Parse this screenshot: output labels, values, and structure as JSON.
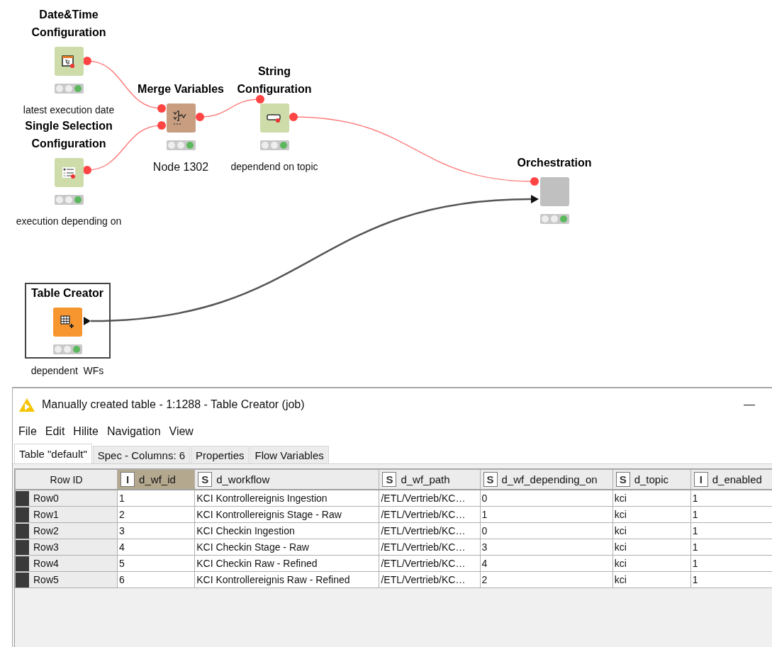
{
  "workflow": {
    "nodes": [
      {
        "kind": "datetime",
        "title": [
          "Date&Time",
          "Configuration"
        ],
        "label": "latest execution date",
        "default_label": false,
        "executed": true,
        "selected": false
      },
      {
        "kind": "selection",
        "title": [
          "Single Selection",
          "Configuration"
        ],
        "label": "execution depending on",
        "default_label": false,
        "executed": true,
        "selected": false
      },
      {
        "kind": "merge",
        "title": [
          "Merge Variables"
        ],
        "label": "Node 1302",
        "default_label": true,
        "executed": true,
        "selected": false
      },
      {
        "kind": "string",
        "title": [
          "String",
          "Configuration"
        ],
        "label": "dependend on topic",
        "default_label": false,
        "executed": true,
        "selected": false
      },
      {
        "kind": "component",
        "title": [
          "Orchestration"
        ],
        "executed": true,
        "selected": false
      },
      {
        "kind": "table",
        "title": [
          "Table Creator"
        ],
        "label": "dependent  WFs",
        "default_label": false,
        "executed": true,
        "selected": true
      }
    ]
  },
  "table_view": {
    "title": "Manually created table - 1:1288 - Table Creator (job)",
    "minimize": "—",
    "menu": [
      "File",
      "Edit",
      "Hilite",
      "Navigation",
      "View"
    ],
    "tabs": [
      {
        "label": "Table \"default\"",
        "selected": true
      },
      {
        "label": "Spec - Columns: 6",
        "selected": false
      },
      {
        "label": "Properties",
        "selected": false
      },
      {
        "label": "Flow Variables",
        "selected": false
      }
    ],
    "row_id_header": "Row ID",
    "columns": [
      {
        "type": "I",
        "name": "d_wf_id",
        "selected": true
      },
      {
        "type": "S",
        "name": "d_workflow",
        "selected": false
      },
      {
        "type": "S",
        "name": "d_wf_path",
        "selected": false
      },
      {
        "type": "S",
        "name": "d_wf_depending_on",
        "selected": false
      },
      {
        "type": "S",
        "name": "d_topic",
        "selected": false
      },
      {
        "type": "I",
        "name": "d_enabled",
        "selected": false
      }
    ],
    "rows": [
      {
        "id": "Row0",
        "cells": [
          "1",
          "KCI Kontrollereignis Ingestion",
          "/ETL/Vertrieb/KC…",
          "0",
          "kci",
          "1"
        ]
      },
      {
        "id": "Row1",
        "cells": [
          "2",
          "KCI Kontrollereignis Stage - Raw",
          "/ETL/Vertrieb/KC…",
          "1",
          "kci",
          "1"
        ]
      },
      {
        "id": "Row2",
        "cells": [
          "3",
          "KCI Checkin Ingestion",
          "/ETL/Vertrieb/KC…",
          "0",
          "kci",
          "1"
        ]
      },
      {
        "id": "Row3",
        "cells": [
          "4",
          "KCI Checkin Stage - Raw",
          "/ETL/Vertrieb/KC…",
          "3",
          "kci",
          "1"
        ]
      },
      {
        "id": "Row4",
        "cells": [
          "5",
          "KCI Checkin Raw - Refined",
          "/ETL/Vertrieb/KC…",
          "4",
          "kci",
          "1"
        ]
      },
      {
        "id": "Row5",
        "cells": [
          "6",
          "KCI Kontrollereignis Raw - Refined",
          "/ETL/Vertrieb/KC…",
          "2",
          "kci",
          "1"
        ]
      }
    ]
  }
}
